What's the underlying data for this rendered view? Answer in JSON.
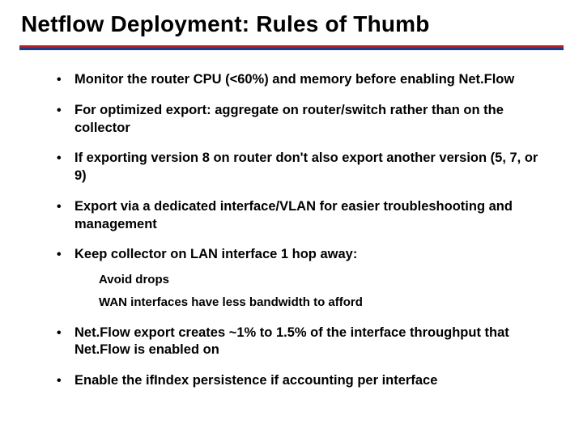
{
  "title": "Netflow Deployment: Rules of Thumb",
  "colors": {
    "red": "#b41e24",
    "blue": "#1a3e8b"
  },
  "bullets": [
    {
      "text": "Monitor the router CPU (<60%) and memory before enabling Net.Flow"
    },
    {
      "text": "For optimized export: aggregate on router/switch rather than on the collector"
    },
    {
      "text": "If exporting version 8 on router don't also export another version (5, 7, or 9)"
    },
    {
      "text": "Export via a dedicated interface/VLAN for easier troubleshooting and management"
    },
    {
      "text": "Keep collector on LAN interface 1 hop away:",
      "sub": [
        "Avoid drops",
        "WAN interfaces have less bandwidth to afford"
      ]
    },
    {
      "text": "Net.Flow export creates ~1% to 1.5% of the interface throughput that Net.Flow is enabled on"
    },
    {
      "text": "Enable the ifIndex persistence if accounting per interface"
    }
  ]
}
